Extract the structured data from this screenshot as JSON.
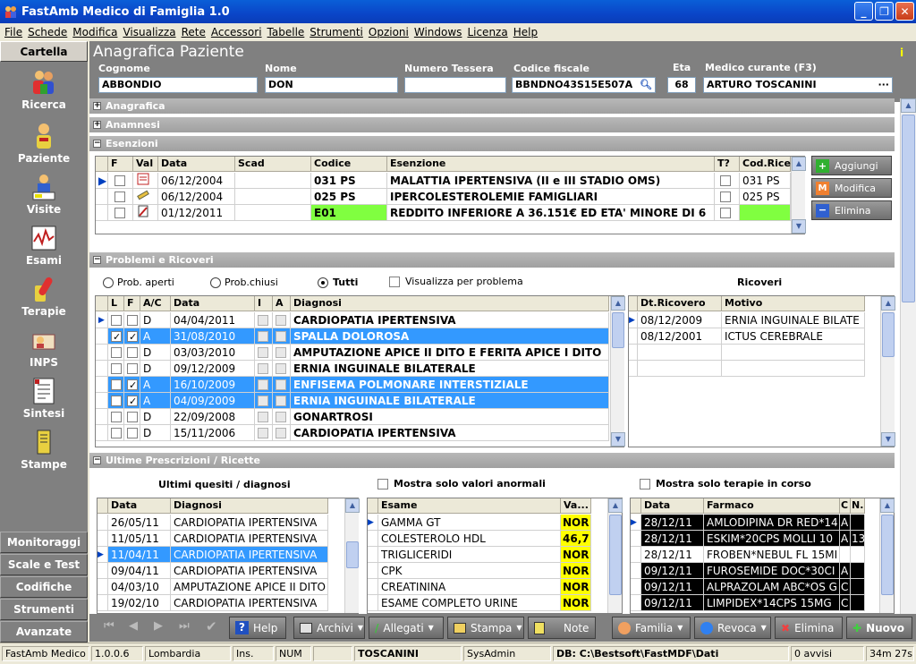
{
  "window": {
    "title": "FastAmb Medico di Famiglia 1.0"
  },
  "menu": [
    "File",
    "Schede",
    "Modifica",
    "Visualizza",
    "Rete",
    "Accessori",
    "Tabelle",
    "Strumenti",
    "Opzioni",
    "Windows",
    "Licenza",
    "Help"
  ],
  "sidebar": {
    "head": "Cartella",
    "items": [
      {
        "label": "Ricerca",
        "icon": "people-icon"
      },
      {
        "label": "Paziente",
        "icon": "patient-icon"
      },
      {
        "label": "Visite",
        "icon": "visit-icon"
      },
      {
        "label": "Esami",
        "icon": "chart-icon"
      },
      {
        "label": "Terapie",
        "icon": "pill-icon"
      },
      {
        "label": "INPS",
        "icon": "inps-icon"
      },
      {
        "label": "Sintesi",
        "icon": "summary-icon"
      },
      {
        "label": "Stampe",
        "icon": "print-icon"
      }
    ],
    "bottom": [
      "Monitoraggi",
      "Scale e Test",
      "Codifiche",
      "Strumenti",
      "Avanzate"
    ]
  },
  "patient": {
    "title": "Anagrafica Paziente",
    "labels": {
      "cognome": "Cognome",
      "nome": "Nome",
      "tessera": "Numero Tessera",
      "cf": "Codice fiscale",
      "eta": "Eta",
      "medico": "Medico curante (F3)"
    },
    "cognome": "ABBONDIO",
    "nome": "DON",
    "tessera": "",
    "cf": "BBNDNO43S15E507A",
    "eta": "68",
    "medico": "ARTURO TOSCANINI"
  },
  "sections": {
    "anagrafica": "Anagrafica",
    "anamnesi": "Anamnesi",
    "esenzioni": "Esenzioni",
    "problemi": "Problemi e Ricoveri",
    "prescrizioni": "Ultime Prescrizioni / Ricette"
  },
  "esenzioni": {
    "headers": [
      "F",
      "Val",
      "Data",
      "Scad",
      "Codice",
      "Esenzione",
      "T?",
      "Cod.Rice"
    ],
    "rows": [
      {
        "data": "06/12/2004",
        "scad": "",
        "codice": "031 PS",
        "esenzione": "MALATTIA IPERTENSIVA (II e III STADIO OMS)",
        "cod": "031 PS"
      },
      {
        "data": "06/12/2004",
        "scad": "",
        "codice": "025 PS",
        "esenzione": "IPERCOLESTEROLEMIE FAMIGLIARI",
        "cod": "025 PS"
      },
      {
        "data": "01/12/2011",
        "scad": "",
        "codice": "E01",
        "esenzione": "REDDITO INFERIORE A 36.151€ ED ETA' MINORE DI 6",
        "cod": ""
      }
    ],
    "buttons": [
      "Aggiungi",
      "Modifica",
      "Elimina"
    ]
  },
  "problemi": {
    "filters": [
      "Prob. aperti",
      "Prob.chiusi",
      "Tutti"
    ],
    "checkbox": "Visualizza per problema",
    "ricoveri_title": "Ricoveri",
    "headers": [
      "L",
      "F",
      "A/C",
      "Data",
      "I",
      "A",
      "Diagnosi"
    ],
    "rows": [
      {
        "l": false,
        "f": false,
        "ac": "D",
        "data": "04/04/2011",
        "diagnosi": "CARDIOPATIA IPERTENSIVA",
        "sel": false
      },
      {
        "l": true,
        "f": true,
        "ac": "A",
        "data": "31/08/2010",
        "diagnosi": "SPALLA DOLOROSA",
        "sel": true
      },
      {
        "l": false,
        "f": false,
        "ac": "D",
        "data": "03/03/2010",
        "diagnosi": "AMPUTAZIONE APICE II DITO E FERITA APICE I DITO",
        "sel": false
      },
      {
        "l": false,
        "f": false,
        "ac": "D",
        "data": "09/12/2009",
        "diagnosi": "ERNIA INGUINALE BILATERALE",
        "sel": false
      },
      {
        "l": false,
        "f": true,
        "ac": "A",
        "data": "16/10/2009",
        "diagnosi": "ENFISEMA POLMONARE INTERSTIZIALE",
        "sel": true
      },
      {
        "l": false,
        "f": true,
        "ac": "A",
        "data": "04/09/2009",
        "diagnosi": "ERNIA INGUINALE BILATERALE",
        "sel": true
      },
      {
        "l": false,
        "f": false,
        "ac": "D",
        "data": "22/09/2008",
        "diagnosi": "GONARTROSI",
        "sel": false
      },
      {
        "l": false,
        "f": false,
        "ac": "D",
        "data": "15/11/2006",
        "diagnosi": "CARDIOPATIA IPERTENSIVA",
        "sel": false
      }
    ],
    "ricoveri_headers": [
      "Dt.Ricovero",
      "Motivo"
    ],
    "ricoveri": [
      {
        "data": "08/12/2009",
        "motivo": "ERNIA INGUINALE BILATE"
      },
      {
        "data": "08/12/2001",
        "motivo": "ICTUS CEREBRALE"
      }
    ]
  },
  "prescrizioni": {
    "quesiti_title": "Ultimi quesiti / diagnosi",
    "anormali": "Mostra solo valori anormali",
    "terapie": "Mostra solo terapie in corso",
    "q_headers": [
      "Data",
      "Diagnosi"
    ],
    "quesiti": [
      {
        "data": "26/05/11",
        "diagnosi": "CARDIOPATIA IPERTENSIVA",
        "sel": false
      },
      {
        "data": "11/05/11",
        "diagnosi": "CARDIOPATIA IPERTENSIVA",
        "sel": false
      },
      {
        "data": "11/04/11",
        "diagnosi": "CARDIOPATIA IPERTENSIVA",
        "sel": true
      },
      {
        "data": "09/04/11",
        "diagnosi": "CARDIOPATIA IPERTENSIVA",
        "sel": false
      },
      {
        "data": "04/03/10",
        "diagnosi": "AMPUTAZIONE APICE II DITO",
        "sel": false
      },
      {
        "data": "19/02/10",
        "diagnosi": "CARDIOPATIA IPERTENSIVA",
        "sel": false
      }
    ],
    "e_headers": [
      "Esame",
      "Va..."
    ],
    "esami": [
      {
        "esame": "GAMMA GT",
        "val": "NOR"
      },
      {
        "esame": "COLESTEROLO HDL",
        "val": "46,7"
      },
      {
        "esame": "TRIGLICERIDI",
        "val": "NOR"
      },
      {
        "esame": "CPK",
        "val": "NOR"
      },
      {
        "esame": "CREATININA",
        "val": "NOR"
      },
      {
        "esame": "ESAME COMPLETO URINE",
        "val": "NOR"
      }
    ],
    "f_headers": [
      "Data",
      "Farmaco",
      "C",
      "N."
    ],
    "farmaci": [
      {
        "data": "28/12/11",
        "farmaco": "AMLODIPINA DR RED*14",
        "c": "A",
        "dark": true
      },
      {
        "data": "28/12/11",
        "farmaco": "ESKIM*20CPS MOLLI 10",
        "c": "A",
        "n": "13",
        "dark": true
      },
      {
        "data": "28/12/11",
        "farmaco": "FROBEN*NEBUL FL 15MI",
        "c": "",
        "dark": false
      },
      {
        "data": "09/12/11",
        "farmaco": "FUROSEMIDE DOC*30CI",
        "c": "A",
        "dark": true
      },
      {
        "data": "09/12/11",
        "farmaco": "ALPRAZOLAM ABC*OS G",
        "c": "C",
        "dark": true
      },
      {
        "data": "09/12/11",
        "farmaco": "LIMPIDEX*14CPS 15MG",
        "c": "C",
        "dark": true
      }
    ]
  },
  "toolbar": {
    "help": "Help",
    "archivi": "Archivi",
    "allegati": "Allegati",
    "stampa": "Stampa",
    "note": "Note",
    "familia": "Familia",
    "revoca": "Revoca",
    "elimina": "Elimina",
    "nuovo": "Nuovo"
  },
  "status": [
    "FastAmb Medico",
    "1.0.0.6",
    "Lombardia",
    "Ins.",
    "NUM",
    "",
    "TOSCANINI",
    "SysAdmin",
    "DB: C:\\Bestsoft\\FastMDF\\Dati",
    "0 avvisi",
    "34m 27s"
  ]
}
